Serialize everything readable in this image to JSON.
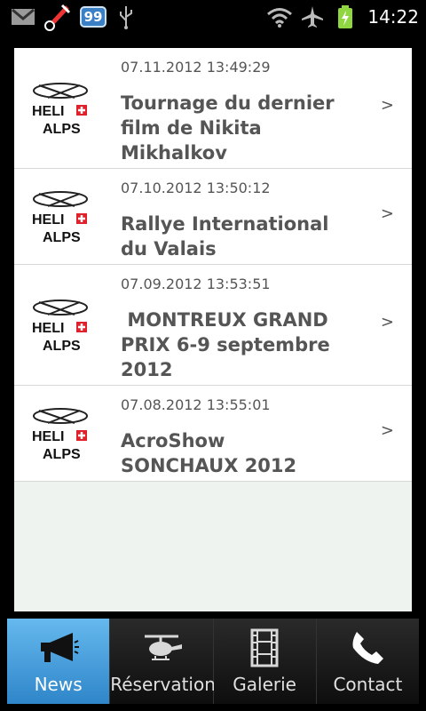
{
  "status_bar": {
    "time": "14:22",
    "notification_count": "99",
    "icons": [
      "gmail-icon",
      "satellite-icon",
      "usb-icon",
      "wifi-icon",
      "airplane-icon",
      "battery-charging-icon"
    ]
  },
  "news": {
    "items": [
      {
        "date": "07.11.2012 13:49:29",
        "title": "Tournage du dernier film de Nikita Mikhalkov",
        "chevron": ">"
      },
      {
        "date": "07.10.2012 13:50:12",
        "title": "Rallye International du Valais",
        "chevron": ">"
      },
      {
        "date": "07.09.2012 13:53:51",
        "title": " MONTREUX GRAND PRIX 6-9 septembre 2012",
        "chevron": ">"
      },
      {
        "date": "07.08.2012 13:55:01",
        "title": "AcroShow SONCHAUX 2012",
        "chevron": ">"
      }
    ],
    "logo": {
      "line1": "HELI",
      "line2": "ALPS"
    }
  },
  "tabs": [
    {
      "label": "News",
      "icon": "megaphone-icon",
      "active": true
    },
    {
      "label": "Réservation",
      "icon": "helicopter-icon",
      "active": false
    },
    {
      "label": "Galerie",
      "icon": "film-strip-icon",
      "active": false
    },
    {
      "label": "Contact",
      "icon": "phone-icon",
      "active": false
    }
  ],
  "colors": {
    "accent": "#3a8fd2",
    "text": "#555555",
    "panel_bg": "#eef3f0"
  }
}
